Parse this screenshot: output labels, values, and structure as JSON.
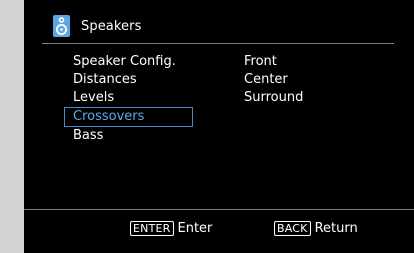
{
  "header": {
    "title": "Speakers",
    "icon": "speaker-icon"
  },
  "menu": {
    "items": [
      {
        "label": "Speaker Config."
      },
      {
        "label": "Distances"
      },
      {
        "label": "Levels"
      },
      {
        "label": "Crossovers",
        "selected": true
      },
      {
        "label": "Bass"
      }
    ]
  },
  "sublist": {
    "items": [
      "Front",
      "Center",
      "Surround"
    ]
  },
  "footer": {
    "enter_key": "ENTER",
    "enter_label": "Enter",
    "back_key": "BACK",
    "back_label": "Return"
  },
  "colors": {
    "background": "#000000",
    "text": "#ffffff",
    "accent": "#5ea8ea",
    "icon": "#5fa6e6",
    "rule": "#7e7e7e"
  }
}
